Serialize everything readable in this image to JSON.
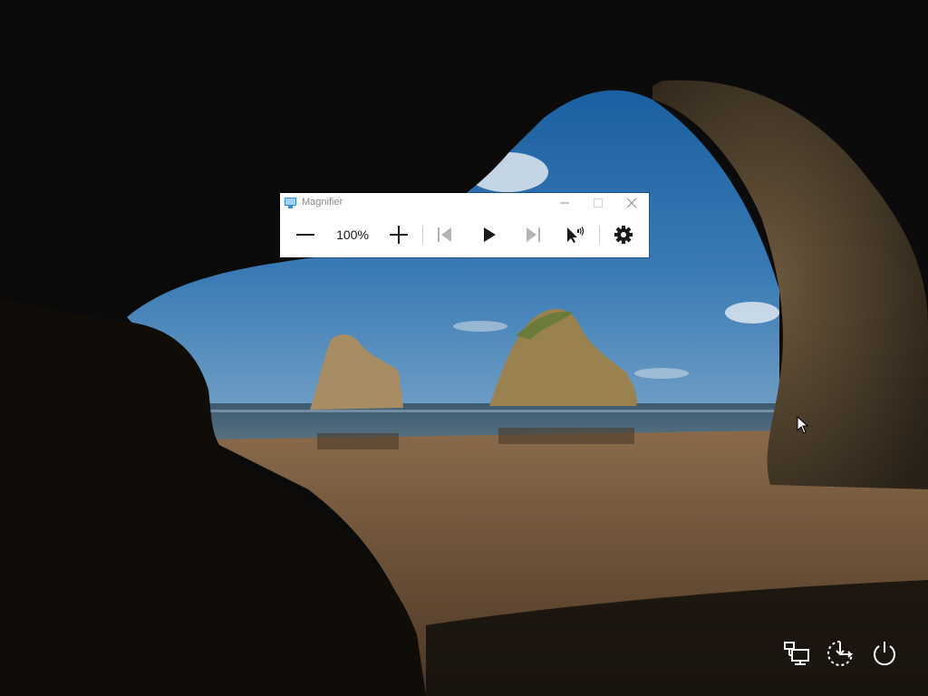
{
  "window": {
    "title": "Magnifier",
    "zoom_level": "100%"
  },
  "icons": {
    "app": "magnifier-icon",
    "zoom_out": "minus-icon",
    "zoom_in": "plus-icon",
    "previous": "skip-back-icon",
    "play": "play-icon",
    "next": "skip-forward-icon",
    "read_from_here": "cursor-speaker-icon",
    "settings": "gear-icon",
    "network": "network-icon",
    "ease_of_access": "ease-of-access-icon",
    "power": "power-icon"
  },
  "colors": {
    "icon": "#1a1a1a",
    "disabled_icon": "#b4b4b4",
    "title_text": "#8a8a8a",
    "lock_icons": "#ffffff"
  }
}
